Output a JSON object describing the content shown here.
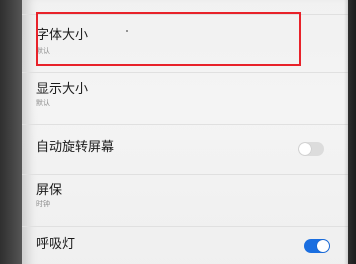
{
  "settings": {
    "items": [
      {
        "title": "字体大小",
        "subtitle": "默认",
        "highlighted": true
      },
      {
        "title": "显示大小",
        "subtitle": "默认"
      },
      {
        "title": "自动旋转屏幕",
        "toggle": "off"
      },
      {
        "title": "屏保",
        "subtitle": "时钟"
      },
      {
        "title": "呼吸灯",
        "toggle": "on"
      }
    ]
  },
  "colors": {
    "highlight_border": "#e8222a",
    "toggle_on": "#1a6ee0",
    "toggle_off": "#dcdcdc",
    "background": "#f2f2f2"
  },
  "icons": {
    "toggle": "switch-toggle"
  }
}
